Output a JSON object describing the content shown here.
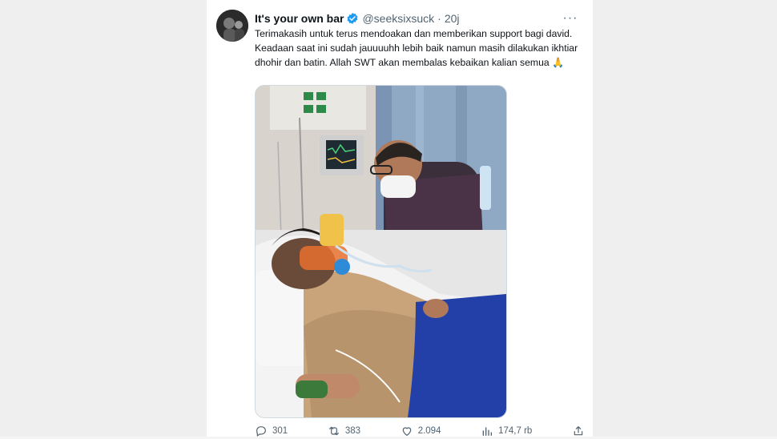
{
  "tweet": {
    "display_name": "It's your own bar",
    "handle": "@seeksixsuck",
    "separator": "·",
    "time": "20j",
    "more_label": "···",
    "text_line_1": "Terimakasih untuk terus mendoakan dan memberikan support bagi david.",
    "text_line_2": "Keadaan saat ini sudah jauuuuhh lebih baik namun masih dilakukan ikhtiar dhohir dan batin. Allah SWT akan membalas kebaikan kalian semua 🙏",
    "media_icon": "photo",
    "actions": {
      "replies": "301",
      "retweets": "383",
      "likes": "2.094",
      "views": "174,7 rb"
    }
  },
  "colors": {
    "accent": "#1d9bf0",
    "text_secondary": "#536471"
  }
}
